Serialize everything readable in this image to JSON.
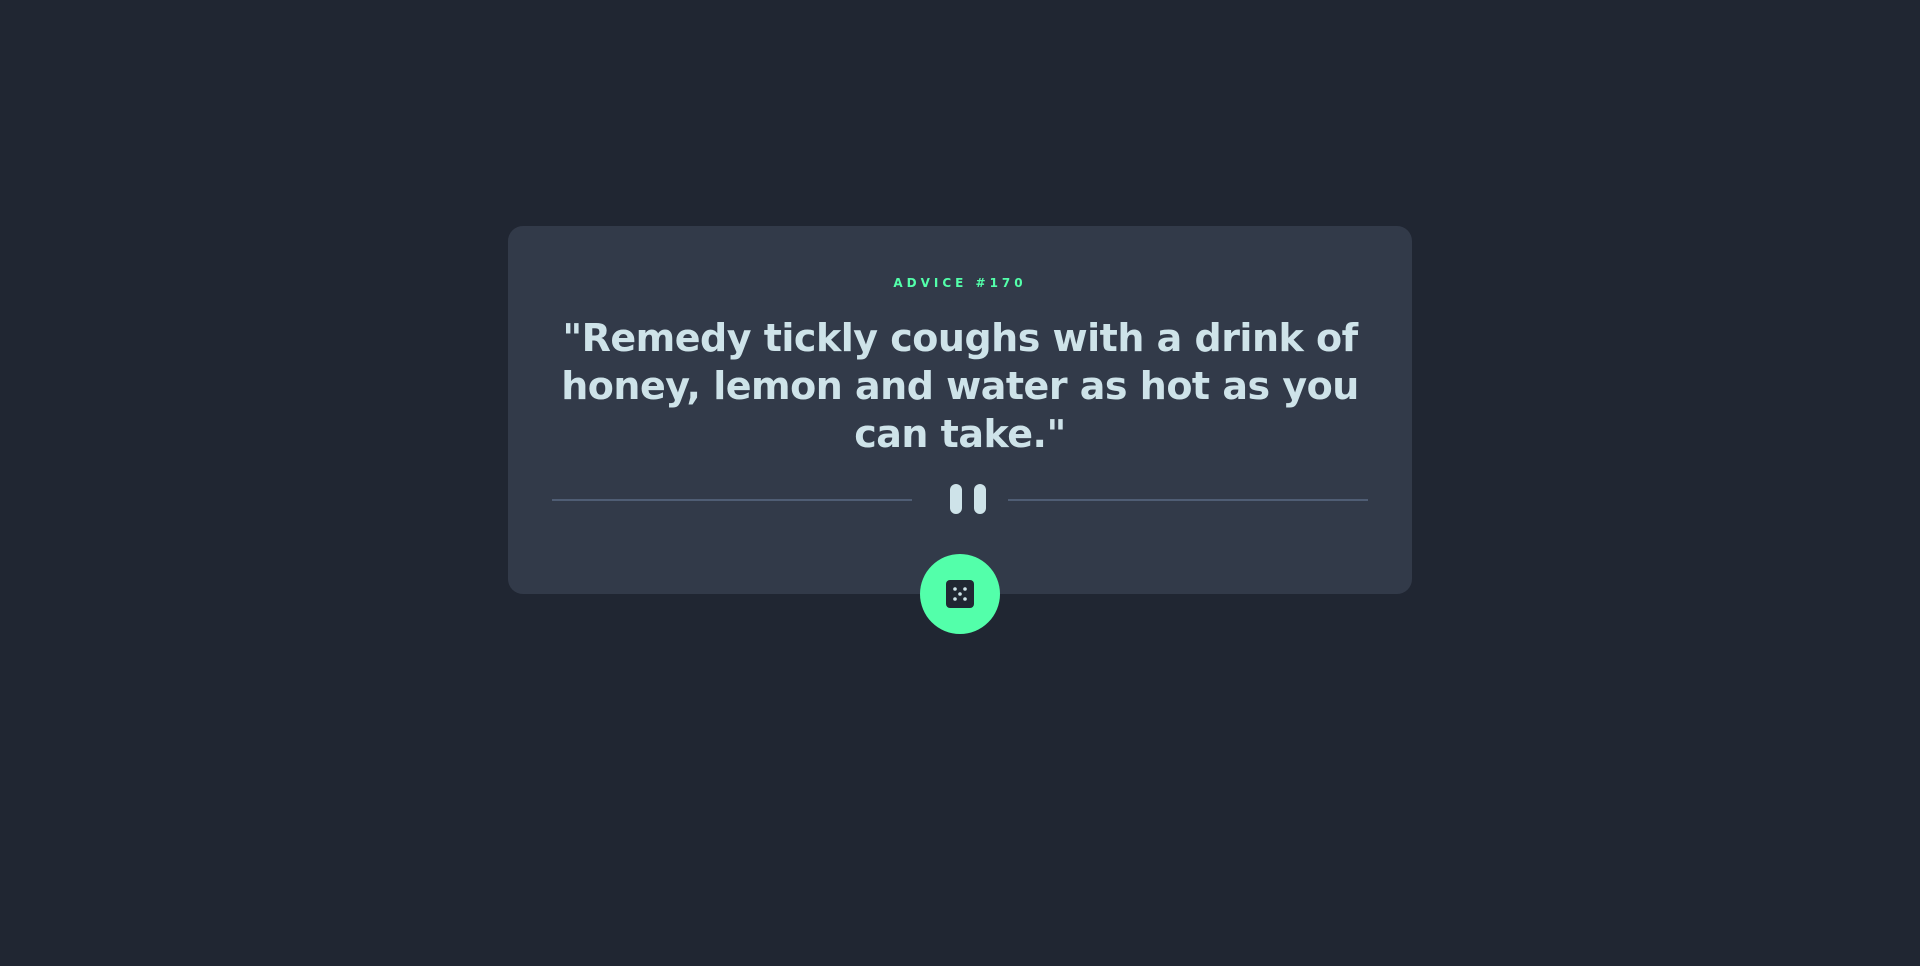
{
  "advice": {
    "label": "ADVICE #170",
    "quote": "\"Remedy tickly coughs with a drink of honey, lemon and water as hot as you can take.\""
  },
  "divider": {
    "icon": "pause-icon"
  },
  "button": {
    "icon": "dice-icon"
  },
  "colors": {
    "background": "#202632",
    "card": "#323a49",
    "accent": "#53ffaa",
    "text": "#cee3e9",
    "divider": "#4f5d74"
  }
}
